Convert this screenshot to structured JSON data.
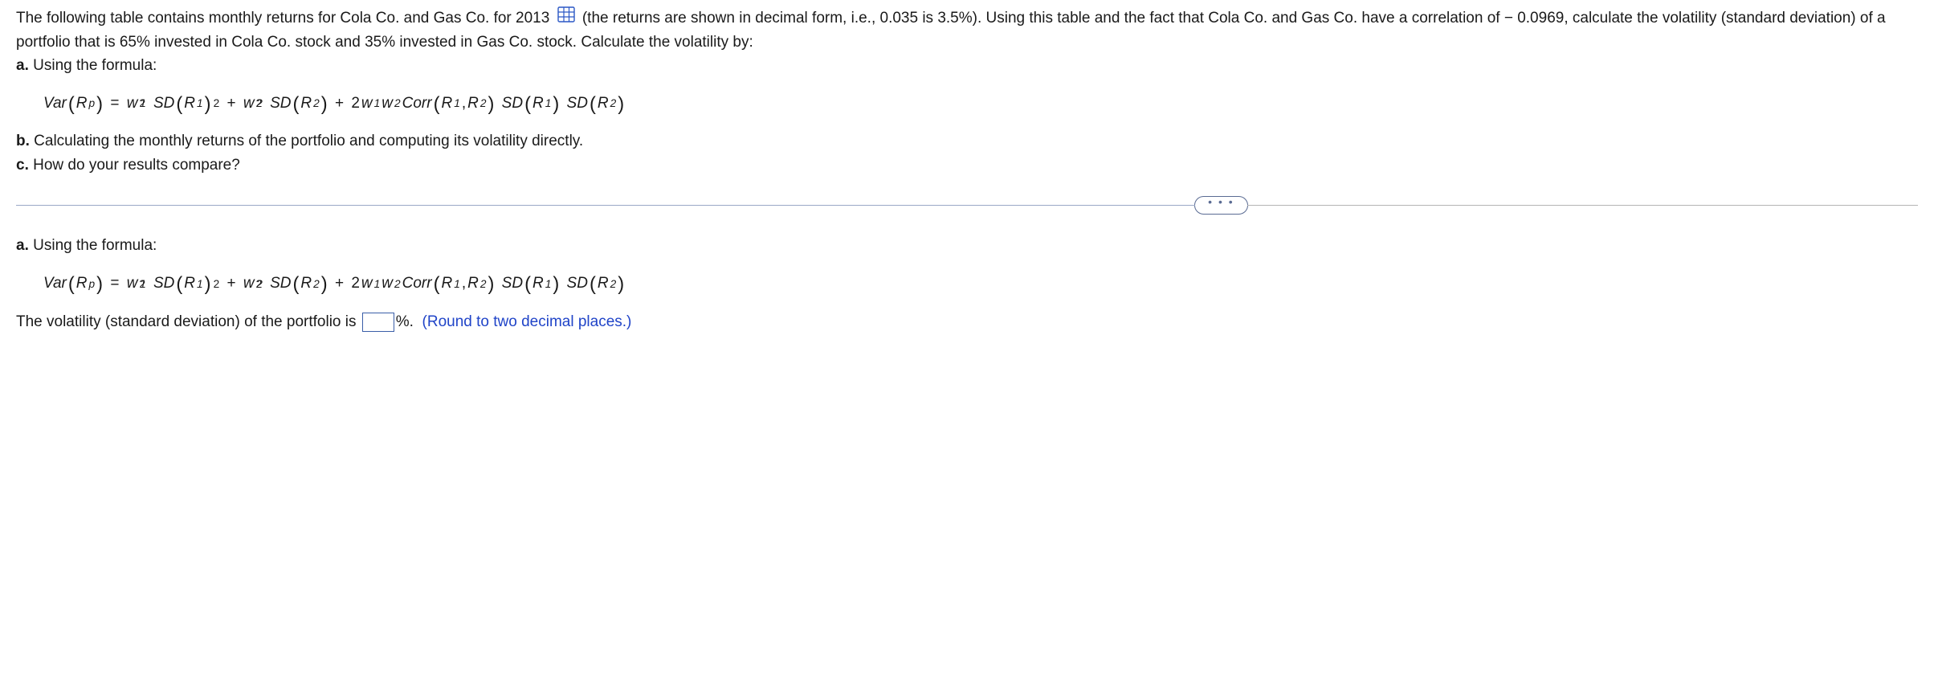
{
  "intro": {
    "part1": "The following table contains monthly returns for Cola Co. and Gas Co. for 2013",
    "part2": "(the returns are shown in decimal form, i.e., 0.035 is 3.5%). Using this table and the fact that Cola Co. and Gas Co. have a correlation of − 0.0969, calculate the volatility (standard deviation) of a portfolio that is 65% invested in Cola Co. stock and 35% invested in Gas Co. stock. Calculate the volatility by:"
  },
  "parts": {
    "a_label": "a.",
    "a_text": "Using the formula:",
    "b_label": "b.",
    "b_text": "Calculating the monthly returns of the portfolio and computing its volatility directly.",
    "c_label": "c.",
    "c_text": "How do your results compare?"
  },
  "answer_section": {
    "a_label": "a.",
    "a_text": "Using the formula:",
    "result_prefix": "The volatility (standard deviation) of the portfolio is",
    "result_suffix": "%.",
    "hint": "(Round to two decimal places.)"
  },
  "formula": {
    "lhs_var": "Var",
    "lhs_sub": "p",
    "eq": "=",
    "w": "w",
    "sd": "SD",
    "r": "R",
    "plus": "+",
    "two": "2",
    "corr": "Corr",
    "comma": ","
  },
  "divider": {
    "dots": "• • •"
  }
}
